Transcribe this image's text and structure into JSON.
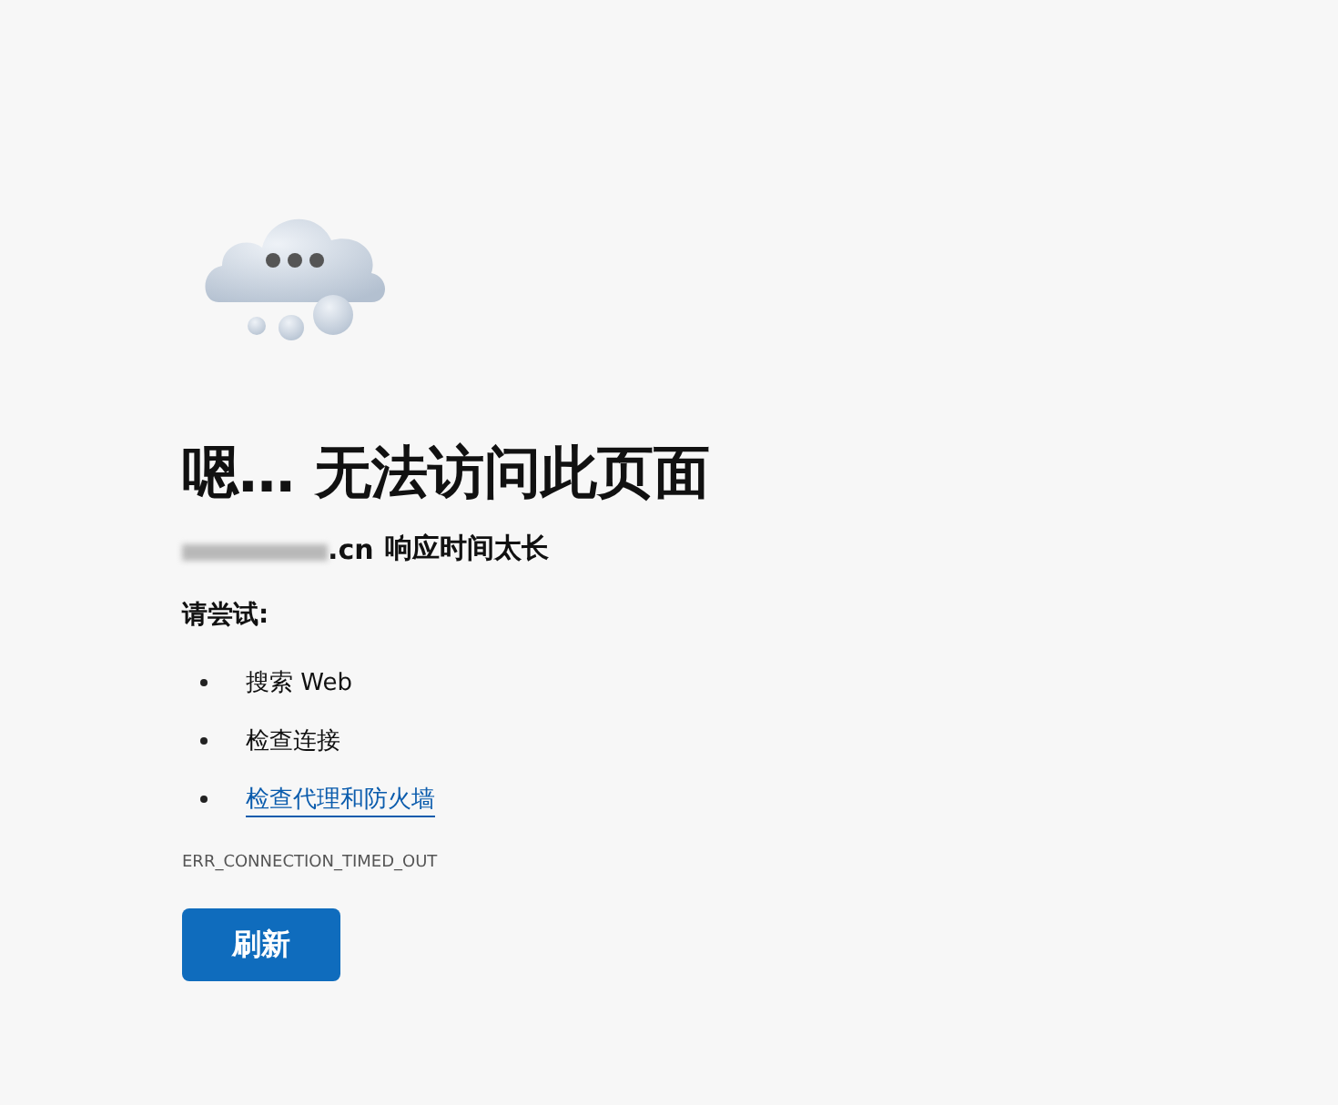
{
  "title": "嗯… 无法访问此页面",
  "host": {
    "visible_suffix": ".cn",
    "message": "响应时间太长"
  },
  "try_heading": "请尝试:",
  "suggestions": [
    {
      "kind": "text",
      "label": "搜索 Web"
    },
    {
      "kind": "text",
      "label": "检查连接"
    },
    {
      "kind": "link",
      "label": "检查代理和防火墙"
    }
  ],
  "error_code": "ERR_CONNECTION_TIMED_OUT",
  "button": "刷新"
}
